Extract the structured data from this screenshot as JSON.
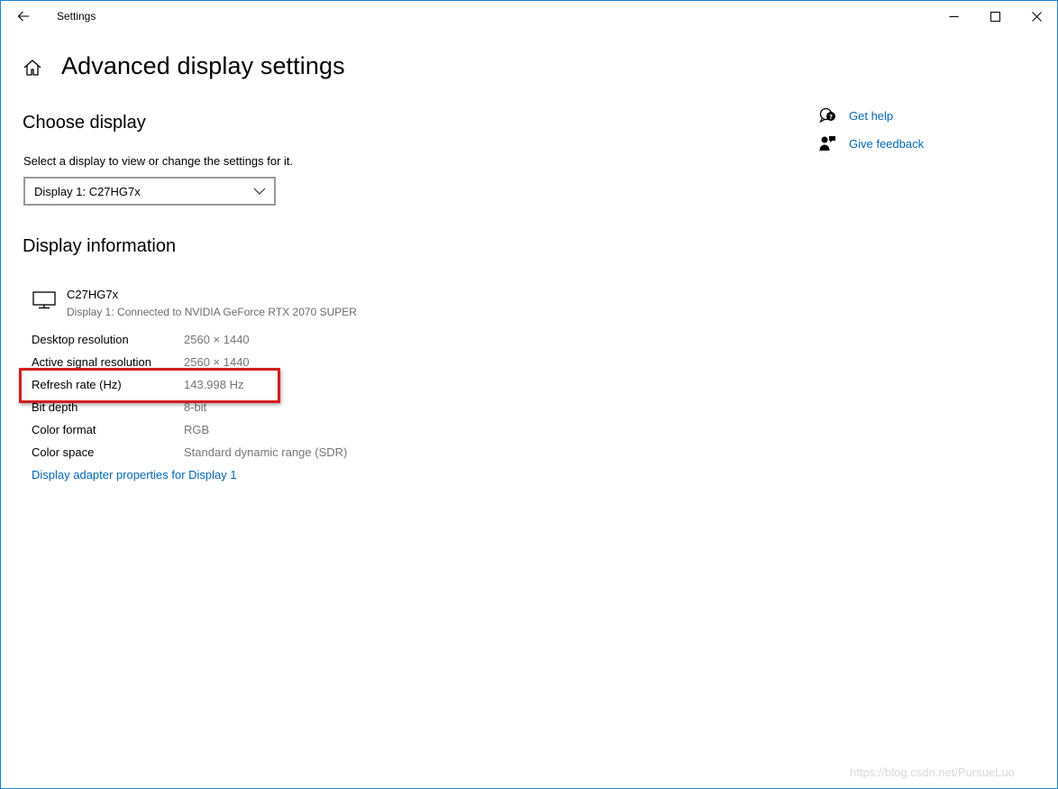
{
  "window": {
    "title": "Settings"
  },
  "header": {
    "page_title": "Advanced display settings"
  },
  "choose_display": {
    "heading": "Choose display",
    "select_label": "Select a display to view or change the settings for it.",
    "selected": "Display 1: C27HG7x"
  },
  "display_info": {
    "heading": "Display information",
    "monitor_name": "C27HG7x",
    "monitor_sub": "Display 1: Connected to NVIDIA GeForce RTX 2070 SUPER",
    "rows": [
      {
        "label": "Desktop resolution",
        "value": "2560 × 1440"
      },
      {
        "label": "Active signal resolution",
        "value": "2560 × 1440"
      },
      {
        "label": "Refresh rate (Hz)",
        "value": "143.998 Hz"
      },
      {
        "label": "Bit depth",
        "value": "8-bit"
      },
      {
        "label": "Color format",
        "value": "RGB"
      },
      {
        "label": "Color space",
        "value": "Standard dynamic range (SDR)"
      }
    ],
    "adapter_link": "Display adapter properties for Display 1"
  },
  "side": {
    "get_help": "Get help",
    "give_feedback": "Give feedback"
  },
  "watermark": "https://blog.csdn.net/PursueLuo",
  "colors": {
    "accent_link": "#0067b8",
    "highlight": "#d51e1e",
    "window_border": "#1883d7"
  },
  "icons": [
    "back-arrow-icon",
    "minimize-icon",
    "maximize-icon",
    "close-icon",
    "home-icon",
    "chevron-down-icon",
    "monitor-icon",
    "help-chat-icon",
    "feedback-person-icon"
  ]
}
